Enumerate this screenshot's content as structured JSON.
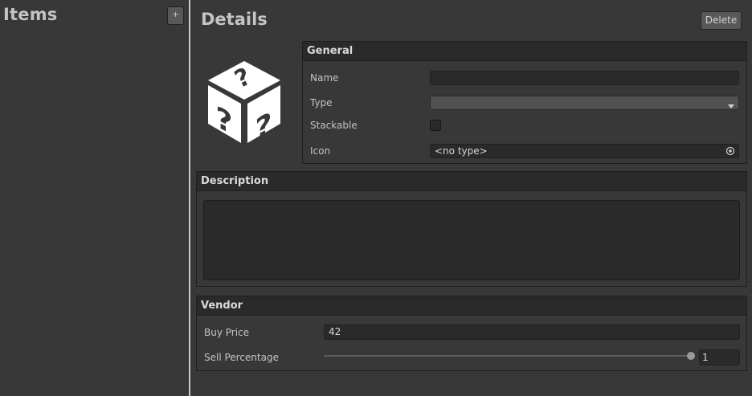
{
  "left_panel": {
    "title": "Items",
    "add_label": "+"
  },
  "right_panel": {
    "title": "Details",
    "delete_label": "Delete"
  },
  "general": {
    "header": "General",
    "name_label": "Name",
    "name_value": "",
    "type_label": "Type",
    "type_value": "",
    "stackable_label": "Stackable",
    "stackable_checked": false,
    "icon_label": "Icon",
    "icon_value": "<no type>"
  },
  "description": {
    "header": "Description",
    "value": ""
  },
  "vendor": {
    "header": "Vendor",
    "buy_price_label": "Buy Price",
    "buy_price_value": "42",
    "sell_percentage_label": "Sell Percentage",
    "sell_percentage_value": "1",
    "sell_percentage_fraction": 1.0
  },
  "icons": {
    "item_preview": "question-dice-icon",
    "dropdown_arrow": "chevron-down-icon",
    "object_picker": "target-icon"
  }
}
